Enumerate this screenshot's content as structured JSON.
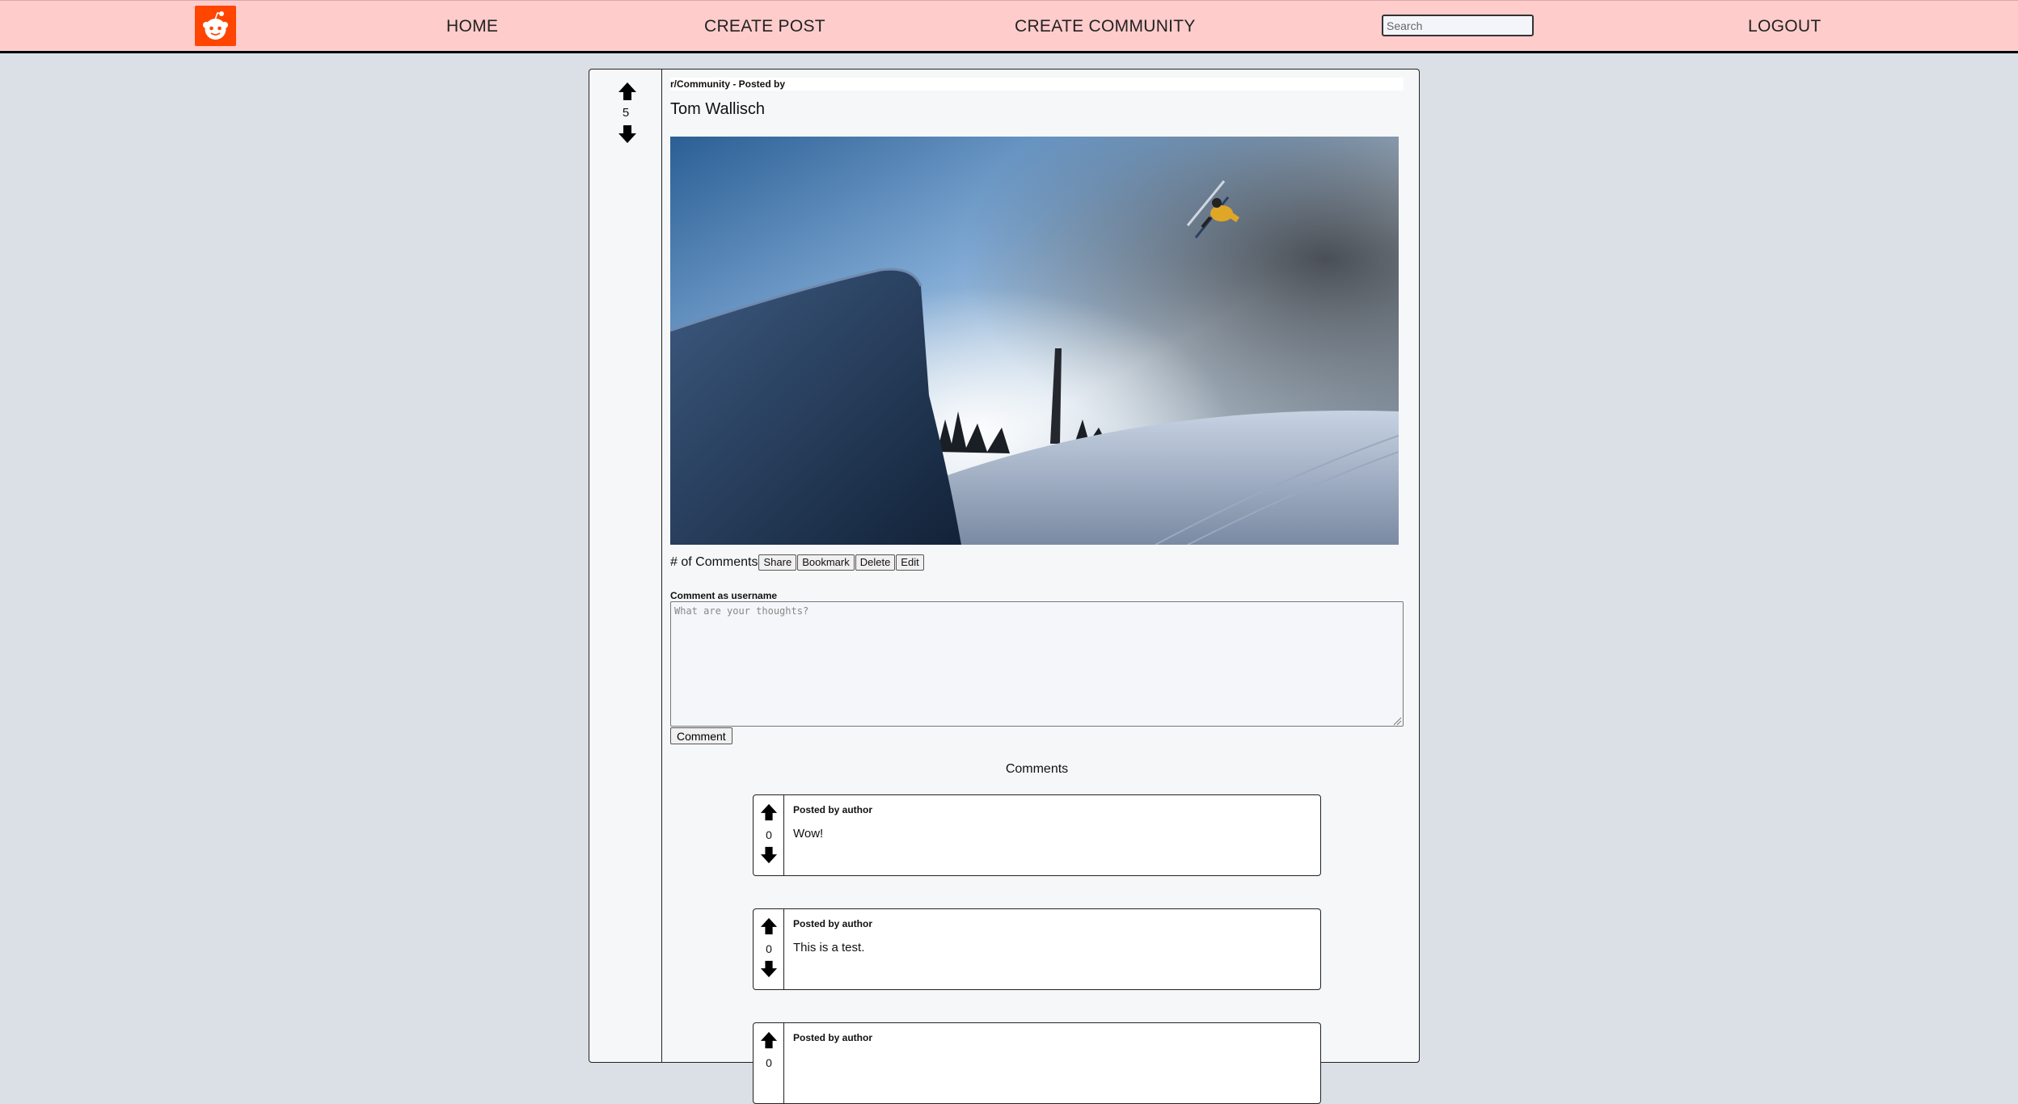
{
  "nav": {
    "links": [
      "HOME",
      "CREATE POST",
      "CREATE COMMUNITY",
      "LOGOUT"
    ],
    "search_placeholder": "Search",
    "brand_color": "#ff4500",
    "bg_color": "#ffcccc"
  },
  "post": {
    "score": "5",
    "meta": "r/Community - Posted by",
    "title": "Tom Wallisch",
    "image_description_icon": "photo",
    "comment_count_label": "# of Comments",
    "actions": [
      "Share",
      "Bookmark",
      "Delete",
      "Edit"
    ]
  },
  "composer": {
    "label": "Comment as username",
    "placeholder": "What are your thoughts?",
    "submit_label": "Comment"
  },
  "comments": {
    "heading": "Comments",
    "items": [
      {
        "score": "0",
        "author": "Posted by author",
        "text": "Wow!"
      },
      {
        "score": "0",
        "author": "Posted by author",
        "text": "This is a test."
      },
      {
        "score": "0",
        "author": "Posted by author",
        "text": ""
      }
    ]
  }
}
